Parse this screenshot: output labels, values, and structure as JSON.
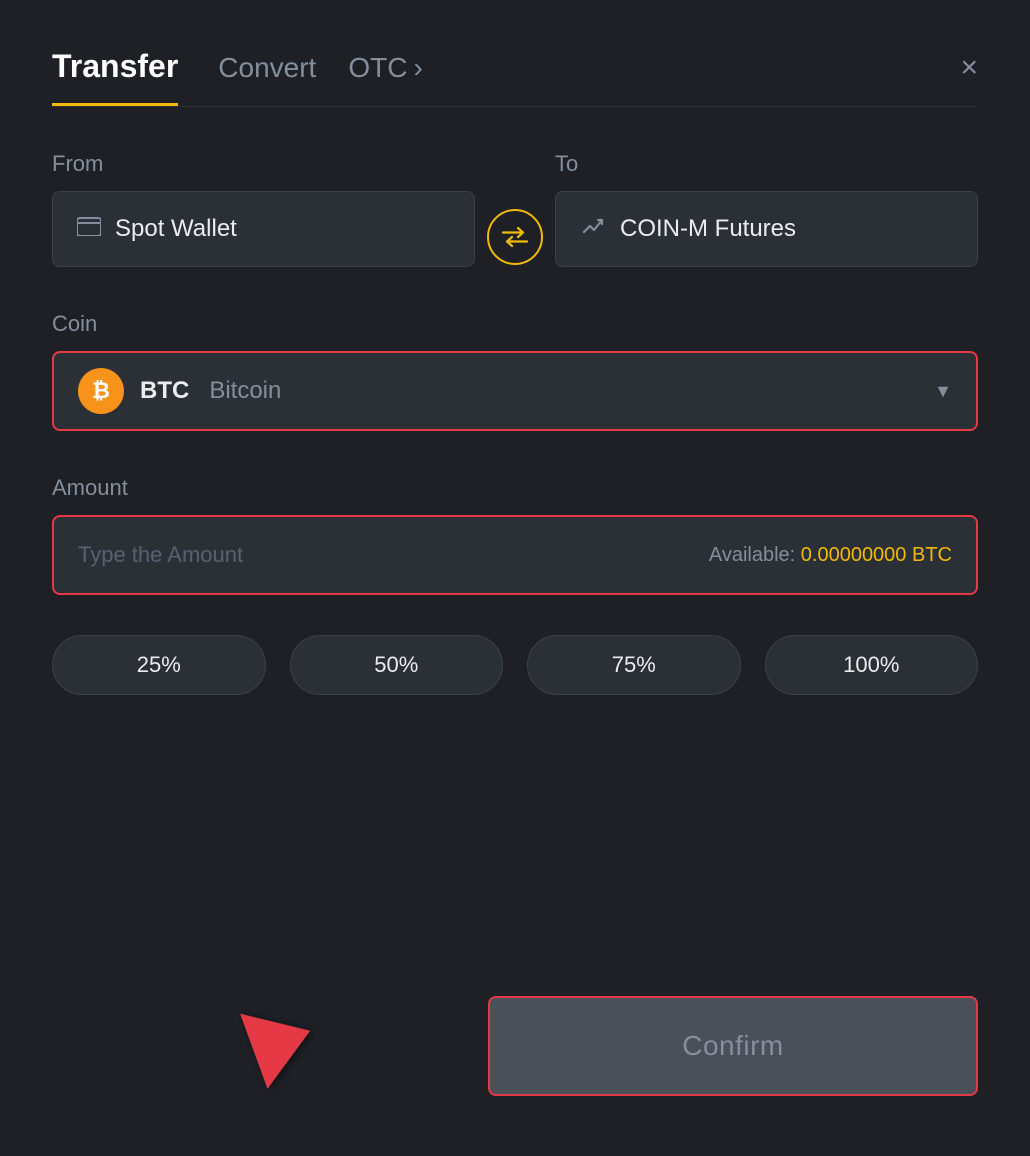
{
  "header": {
    "tab_transfer": "Transfer",
    "tab_convert": "Convert",
    "tab_otc": "OTC",
    "close_label": "×"
  },
  "from_section": {
    "label": "From",
    "wallet_label": "Spot Wallet"
  },
  "to_section": {
    "label": "To",
    "wallet_label": "COIN-M Futures"
  },
  "coin_section": {
    "label": "Coin",
    "coin_symbol": "BTC",
    "coin_name": "Bitcoin"
  },
  "amount_section": {
    "label": "Amount",
    "placeholder": "Type the Amount",
    "available_label": "Available:",
    "available_value": "0.00000000 BTC"
  },
  "percent_buttons": [
    "25%",
    "50%",
    "75%",
    "100%"
  ],
  "confirm_button": "Confirm",
  "colors": {
    "accent": "#f0b90b",
    "danger": "#e63946",
    "text_primary": "#eaecef",
    "text_secondary": "#848e9c",
    "bg_card": "#2b2f36"
  }
}
